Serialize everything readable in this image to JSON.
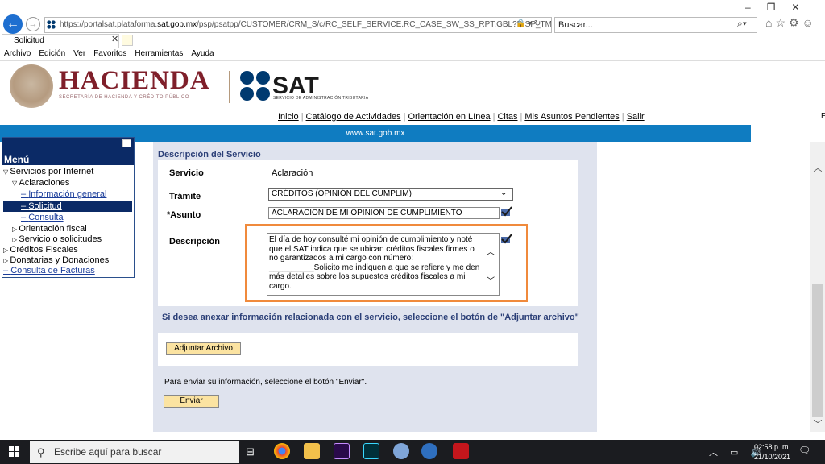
{
  "browser": {
    "url_prefix": "https://portalsat.plataforma.",
    "url_domain": "sat.gob.mx",
    "url_rest": "/psp/psatpp/CUSTOMER/CRM_S/c/RC_SELF_SERVICE.RC_CASE_SW_SS_RPT.GBL?DISP_TMPL_ID=RC_SUPI",
    "search_placeholder": "Buscar...",
    "tab_title": "Solicitud",
    "menu": [
      "Archivo",
      "Edición",
      "Ver",
      "Favoritos",
      "Herramientas",
      "Ayuda"
    ]
  },
  "header": {
    "hacienda": "HACIENDA",
    "hacienda_sub": "SECRETARÍA DE HACIENDA Y CRÉDITO PÚBLICO",
    "sat": "SAT",
    "sat_sub": "SERVICIO DE ADMINISTRACIÓN TRIBUTARIA",
    "nav": [
      "Inicio",
      "Catálogo de Actividades",
      "Orientación en Línea",
      "Citas",
      "Mis Asuntos Pendientes",
      "Salir"
    ],
    "site": "www.sat.gob.mx",
    "edge_letter": "E"
  },
  "sidebar": {
    "title": "Menú",
    "items": [
      {
        "label": "Servicios por Internet"
      },
      {
        "label": "Aclaraciones"
      },
      {
        "label": "Información general"
      },
      {
        "label": "Solicitud"
      },
      {
        "label": "Consulta"
      },
      {
        "label": "Orientación fiscal"
      },
      {
        "label": "Servicio o solicitudes"
      },
      {
        "label": "Créditos Fiscales"
      },
      {
        "label": "Donatarias y Donaciones"
      },
      {
        "label": "Consulta de Facturas"
      }
    ]
  },
  "form": {
    "section_title": "Descripción del Servicio",
    "servicio_label": "Servicio",
    "servicio_value": "Aclaración",
    "tramite_label": "Trámite",
    "tramite_value": "CRÉDITOS (OPINIÓN DEL CUMPLIM)",
    "asunto_label": "*Asunto",
    "asunto_value": "ACLARACION DE MI OPINION DE CUMPLIMIENTO",
    "descripcion_label": "Descripción",
    "descripcion_value": "El día de hoy consulté mi opinión de cumplimiento y noté que el SAT indica que se ubican créditos fiscales firmes o no garantizados a mi cargo con número: __________Solicito me indiquen a que se refiere y me den más detalles sobre los supuestos créditos fiscales a mi cargo.",
    "anexar_text": "Si desea anexar información relacionada con el servicio, seleccione el botón de \"Adjuntar archivo\"",
    "adjuntar_label": "Adjuntar Archivo",
    "enviar_text": "Para enviar su información, seleccione el botón \"Enviar\".",
    "enviar_label": "Enviar"
  },
  "taskbar": {
    "search_placeholder": "Escribe aquí para buscar",
    "time": "02:58 p. m.",
    "date": "21/10/2021"
  },
  "colors": {
    "hacienda": "#7f1f2a",
    "sat_blue": "#003a70",
    "bluebar": "#0f7cc1",
    "menu_navy": "#0b2a66",
    "highlight": "#f08a3c",
    "button": "#fbe3a1"
  }
}
